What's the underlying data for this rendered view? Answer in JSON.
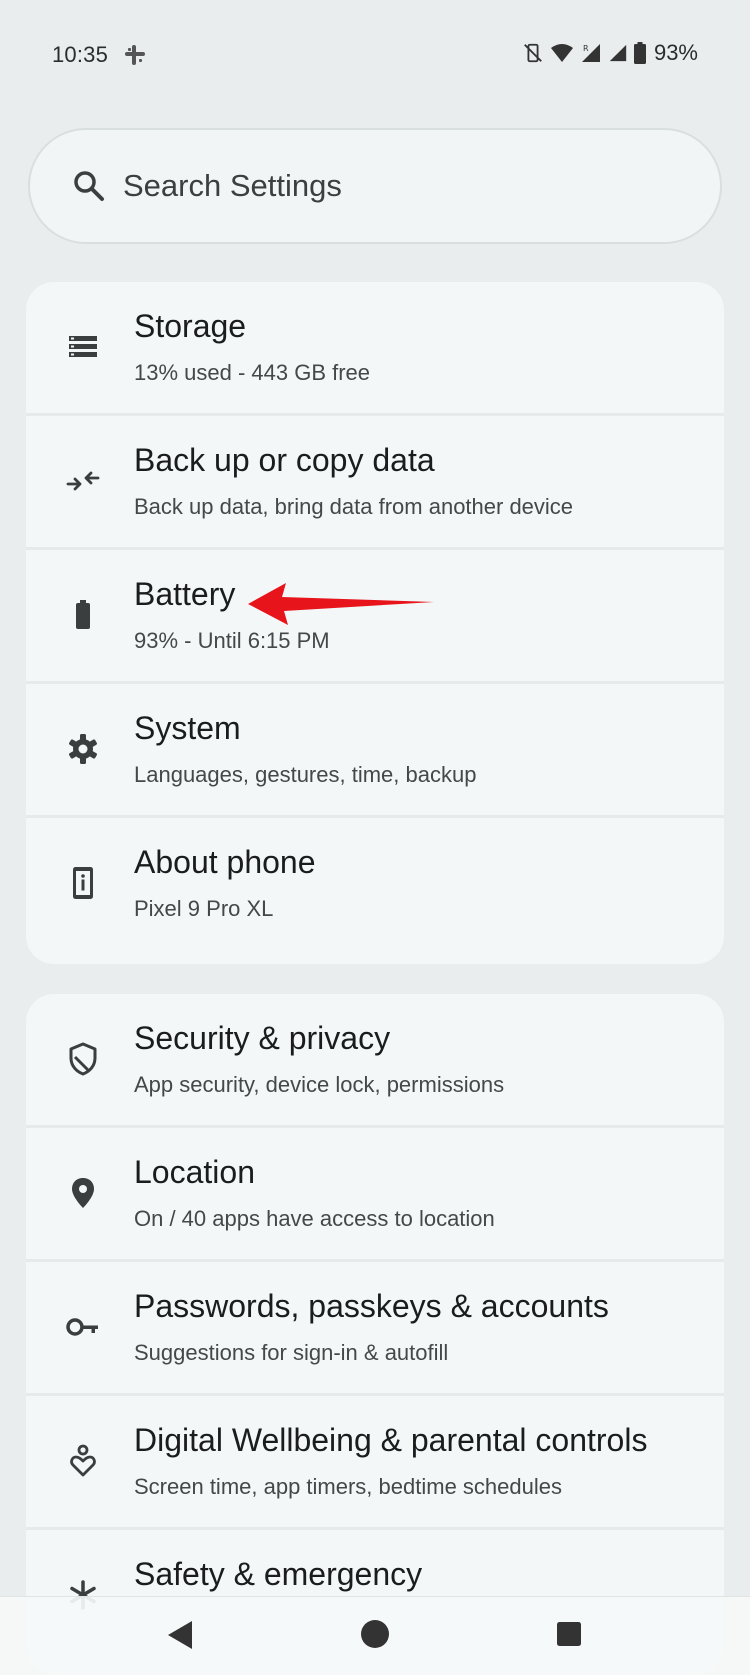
{
  "status_bar": {
    "time": "10:35",
    "battery_percent": "93%",
    "icons": [
      "slack-icon",
      "vibrate-off-icon",
      "wifi-icon",
      "signal-roaming-icon",
      "signal-icon",
      "battery-icon"
    ]
  },
  "search": {
    "placeholder": "Search Settings"
  },
  "groups": [
    {
      "items": [
        {
          "icon": "storage-icon",
          "title": "Storage",
          "subtitle": "13% used - 443 GB free"
        },
        {
          "icon": "backup-transfer-icon",
          "title": "Back up or copy data",
          "subtitle": "Back up data, bring data from another device"
        },
        {
          "icon": "battery-icon",
          "title": "Battery",
          "subtitle": "93% - Until 6:15 PM"
        },
        {
          "icon": "gear-icon",
          "title": "System",
          "subtitle": "Languages, gestures, time, backup"
        },
        {
          "icon": "phone-info-icon",
          "title": "About phone",
          "subtitle": "Pixel 9 Pro XL"
        }
      ]
    },
    {
      "items": [
        {
          "icon": "shield-icon",
          "title": "Security & privacy",
          "subtitle": "App security, device lock, permissions"
        },
        {
          "icon": "location-pin-icon",
          "title": "Location",
          "subtitle": "On / 40 apps have access to location"
        },
        {
          "icon": "key-icon",
          "title": "Passwords, passkeys & accounts",
          "subtitle": "Suggestions for sign-in & autofill"
        },
        {
          "icon": "wellbeing-icon",
          "title": "Digital Wellbeing & parental controls",
          "subtitle": "Screen time, app timers, bedtime schedules"
        },
        {
          "icon": "asterisk-icon",
          "title": "Safety & emergency",
          "subtitle": ""
        }
      ]
    }
  ],
  "annotation": {
    "color": "#e8141b",
    "target": "Battery"
  },
  "colors": {
    "background": "#e9eded",
    "card": "#f3f7f7",
    "text_primary": "#1b1c1c",
    "text_secondary": "#444848"
  }
}
